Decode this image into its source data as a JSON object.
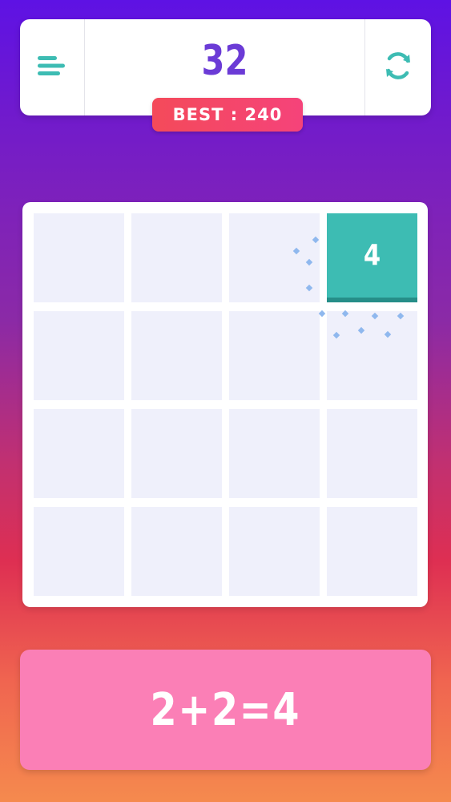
{
  "header": {
    "score": "32",
    "best_label": "BEST : 240"
  },
  "board": {
    "rows": 4,
    "cols": 4,
    "tiles": [
      {
        "value": "4",
        "row": 1,
        "col": 4
      }
    ]
  },
  "formula": "2+2=4",
  "icons": {
    "menu": "menu-icon",
    "refresh": "refresh-icon"
  },
  "colors": {
    "accent": "#3dbcb3",
    "score": "#6b3bd6",
    "best_badge": "#f44a5a",
    "formula_panel": "#fb7fb6",
    "empty_cell": "#eff0fb"
  }
}
